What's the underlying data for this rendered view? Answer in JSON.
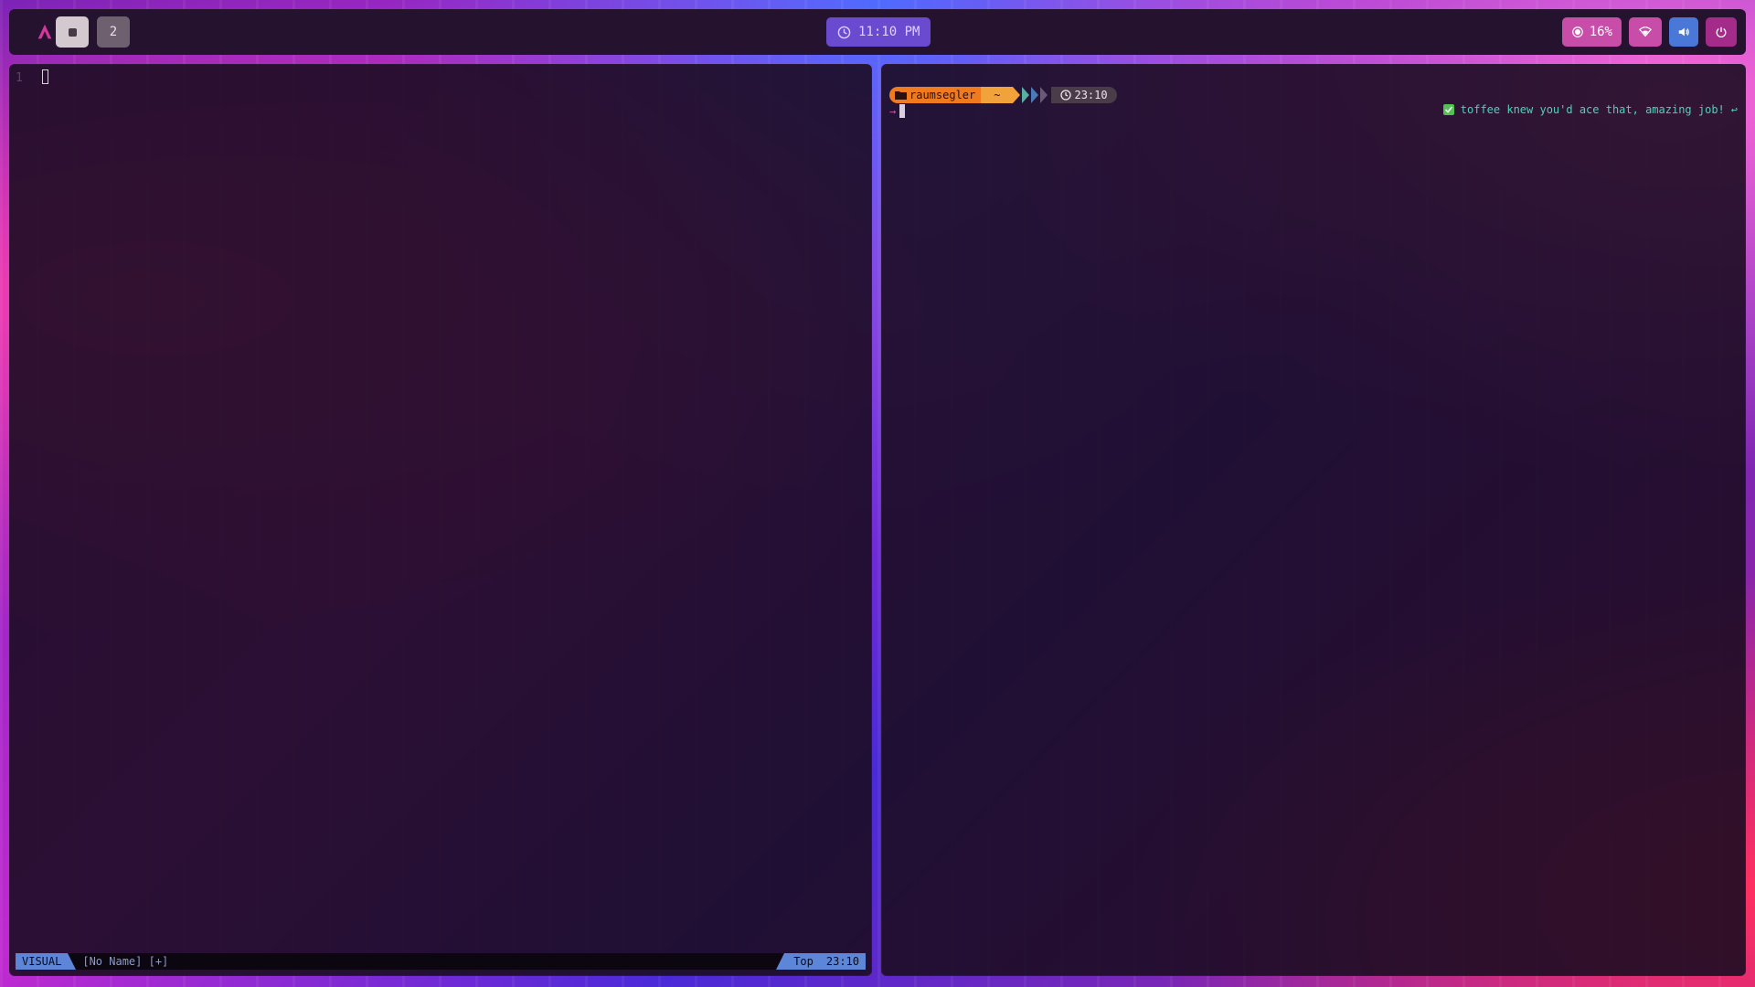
{
  "topbar": {
    "workspaces": [
      {
        "label": "",
        "active": true
      },
      {
        "label": "2",
        "active": false
      }
    ],
    "clock": "11:10 PM",
    "brightness": "16%",
    "icons": [
      "arch-logo-icon",
      "clock-icon",
      "brightness-icon",
      "wifi-icon",
      "volume-icon",
      "power-icon"
    ]
  },
  "editor": {
    "line_number": "1",
    "mode": "VISUAL",
    "file": "[No Name] [+]",
    "position": "Top",
    "cursor_pos": "23:10"
  },
  "terminal": {
    "user": "raumsegler",
    "path": "~",
    "time": "23:10",
    "prompt_symbol": "→",
    "message": "toffee knew you'd ace that, amazing job!",
    "message_tail": "↩"
  },
  "colors": {
    "accent_pink": "#c84da8",
    "accent_purple": "#6a4bd0",
    "accent_blue": "#5d86d8",
    "prompt_orange": "#f07b1f"
  }
}
